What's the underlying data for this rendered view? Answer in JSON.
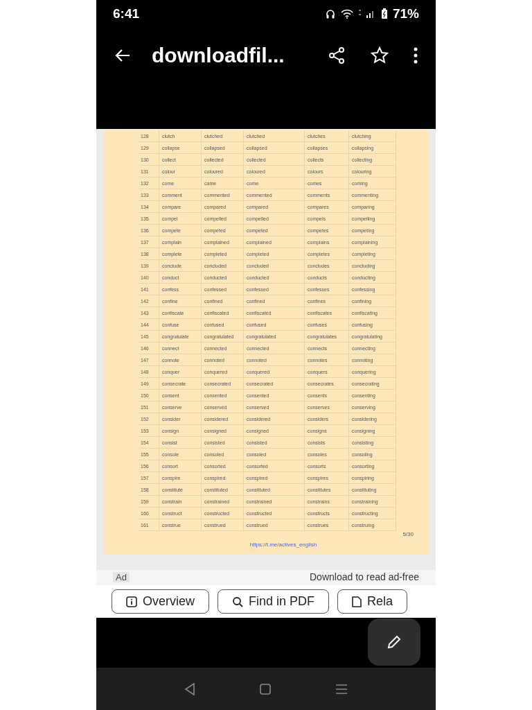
{
  "status_bar": {
    "time": "6:41",
    "battery": "71%"
  },
  "app_bar": {
    "title": "downloadfil..."
  },
  "document": {
    "rows": [
      [
        "128",
        "clutch",
        "clutched",
        "clutched",
        "clutches",
        "clutching"
      ],
      [
        "129",
        "collapse",
        "collapsed",
        "collapsed",
        "collapses",
        "collapsing"
      ],
      [
        "130",
        "collect",
        "collected",
        "collected",
        "collects",
        "collecting"
      ],
      [
        "131",
        "colour",
        "coloured",
        "coloured",
        "colours",
        "colouring"
      ],
      [
        "132",
        "come",
        "came",
        "come",
        "comes",
        "coming"
      ],
      [
        "133",
        "comment",
        "commented",
        "commented",
        "comments",
        "commenting"
      ],
      [
        "134",
        "compare",
        "compared",
        "compared",
        "compares",
        "comparing"
      ],
      [
        "135",
        "compel",
        "compelled",
        "compelled",
        "compels",
        "compelling"
      ],
      [
        "136",
        "compete",
        "competed",
        "competed",
        "competes",
        "competing"
      ],
      [
        "137",
        "complain",
        "complained",
        "complained",
        "complains",
        "complaining"
      ],
      [
        "138",
        "complete",
        "completed",
        "completed",
        "completes",
        "completing"
      ],
      [
        "139",
        "conclude",
        "concluded",
        "concluded",
        "concludes",
        "concluding"
      ],
      [
        "140",
        "conduct",
        "conducted",
        "conducted",
        "conducts",
        "conducting"
      ],
      [
        "141",
        "confess",
        "confessed",
        "confessed",
        "confesses",
        "confessing"
      ],
      [
        "142",
        "confine",
        "confined",
        "confined",
        "confines",
        "confining"
      ],
      [
        "143",
        "confiscate",
        "confiscated",
        "confiscated",
        "confiscates",
        "confiscating"
      ],
      [
        "144",
        "confuse",
        "confused",
        "confused",
        "confuses",
        "confusing"
      ],
      [
        "145",
        "congratulate",
        "congratulated",
        "congratulated",
        "congratulates",
        "congratulating"
      ],
      [
        "146",
        "connect",
        "connected",
        "connected",
        "connects",
        "connecting"
      ],
      [
        "147",
        "connote",
        "connoted",
        "connoted",
        "connotes",
        "connoting"
      ],
      [
        "148",
        "conquer",
        "conquered",
        "conquered",
        "conquers",
        "conquering"
      ],
      [
        "149",
        "consecrate",
        "consecrated",
        "consecrated",
        "consecrates",
        "consecrating"
      ],
      [
        "150",
        "consent",
        "consented",
        "consented",
        "consents",
        "consenting"
      ],
      [
        "151",
        "conserve",
        "conserved",
        "conserved",
        "conserves",
        "conserving"
      ],
      [
        "152",
        "consider",
        "considered",
        "considered",
        "considers",
        "considering"
      ],
      [
        "153",
        "consign",
        "consigned",
        "consigned",
        "consigns",
        "consigning"
      ],
      [
        "154",
        "consist",
        "consisted",
        "consisted",
        "consists",
        "consisting"
      ],
      [
        "155",
        "console",
        "consoled",
        "consoled",
        "consoles",
        "consoling"
      ],
      [
        "156",
        "consort",
        "consorted",
        "consorted",
        "consorts",
        "consorting"
      ],
      [
        "157",
        "conspire",
        "conspired",
        "conspired",
        "conspires",
        "conspiring"
      ],
      [
        "158",
        "constitute",
        "constituted",
        "constituted",
        "constitutes",
        "constituting"
      ],
      [
        "159",
        "constrain",
        "constrained",
        "constrained",
        "constrains",
        "constraining"
      ],
      [
        "160",
        "construct",
        "constructed",
        "constructed",
        "constructs",
        "constructing"
      ],
      [
        "161",
        "construe",
        "construed",
        "construed",
        "construes",
        "construing"
      ]
    ],
    "page_number": "5/30",
    "link": "https://t.me/actives_english"
  },
  "ad": {
    "label": "Ad",
    "text": "Download to read ad-free"
  },
  "chips": [
    {
      "label": "Overview",
      "kind": "info"
    },
    {
      "label": "Find in PDF",
      "kind": "search"
    },
    {
      "label": "Rela",
      "kind": "doc"
    }
  ]
}
